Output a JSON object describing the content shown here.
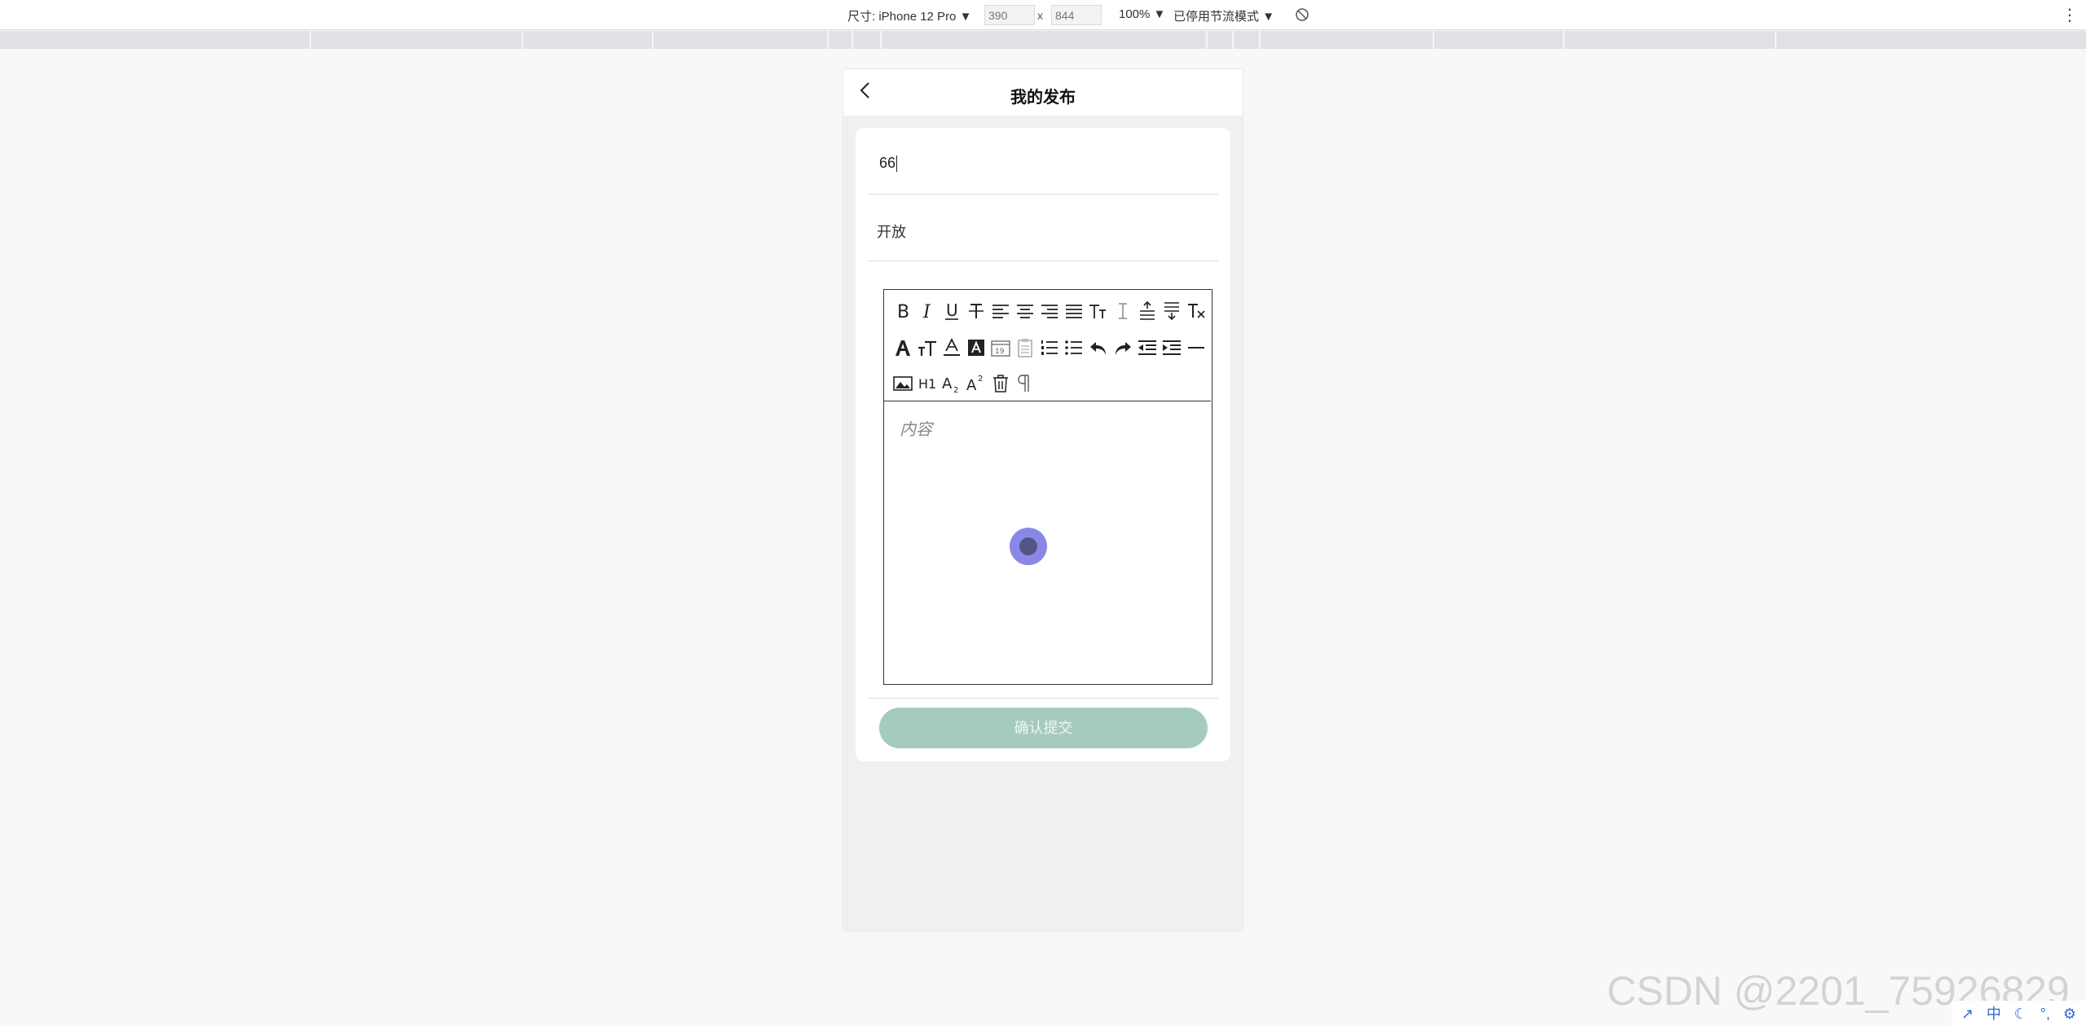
{
  "devtools": {
    "device_label": "尺寸: iPhone 12 Pro",
    "width_value": "390",
    "height_value": "844",
    "times": "x",
    "zoom_label": "100%",
    "throttle_label": "已停用节流模式",
    "dropdown_arrow": "▼",
    "more_glyph": "⋮"
  },
  "nav": {
    "title": "我的发布",
    "back_icon": "chevron-left-icon"
  },
  "form": {
    "title_value": "66",
    "status_value": "开放",
    "content_placeholder": "内容",
    "submit_label": "确认提交"
  },
  "toolbar": {
    "rows": [
      [
        "bold",
        "italic",
        "underline",
        "strikethrough",
        "align-left",
        "align-center",
        "align-right",
        "align-justify",
        "text-transform",
        "letter-spacing",
        "line-height-up",
        "line-height-down",
        "clear-format"
      ],
      [
        "font-family",
        "font-size",
        "font-color",
        "background-color",
        "date",
        "clipboard",
        "ordered-list",
        "bullet-list",
        "undo",
        "redo",
        "outdent",
        "indent",
        "horizontal-rule"
      ],
      [
        "image",
        "heading",
        "subscript",
        "superscript",
        "clear-all",
        "paragraph-mark"
      ]
    ],
    "text_glyphs": {
      "heading": "H1",
      "bold": "B",
      "italic": "I",
      "underline": "U"
    }
  },
  "colors": {
    "submit_bg": "#a5cbc0",
    "touch_outer": "#8a88e6",
    "touch_inner": "#545385"
  },
  "watermark": "CSDN @2201_75926829",
  "tray": [
    "↗",
    "中",
    "☾",
    "°,",
    "⚙"
  ]
}
